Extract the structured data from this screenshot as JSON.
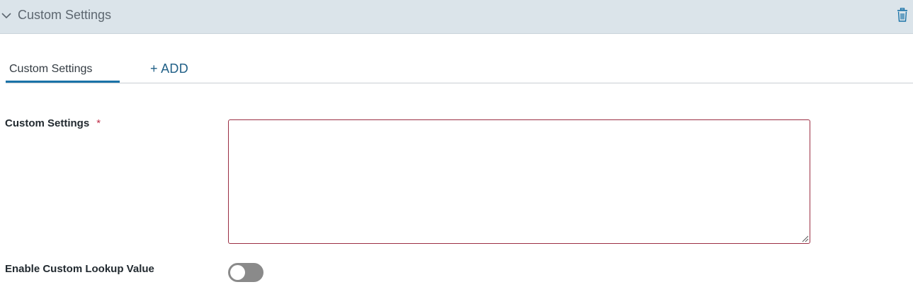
{
  "header": {
    "title": "Custom Settings",
    "chevron_icon": "chevron-down-icon",
    "trash_icon": "trash-icon",
    "background_color": "#dbe4ea"
  },
  "tabs": {
    "items": [
      {
        "label": "Custom Settings",
        "active": true
      }
    ],
    "add_label": "+ ADD",
    "accent_color": "#1a73a8"
  },
  "form": {
    "custom_settings": {
      "label": "Custom Settings",
      "required_marker": "*",
      "value": ""
    },
    "custom_lookup": {
      "label": "Enable Custom Lookup Value",
      "enabled": false
    }
  }
}
